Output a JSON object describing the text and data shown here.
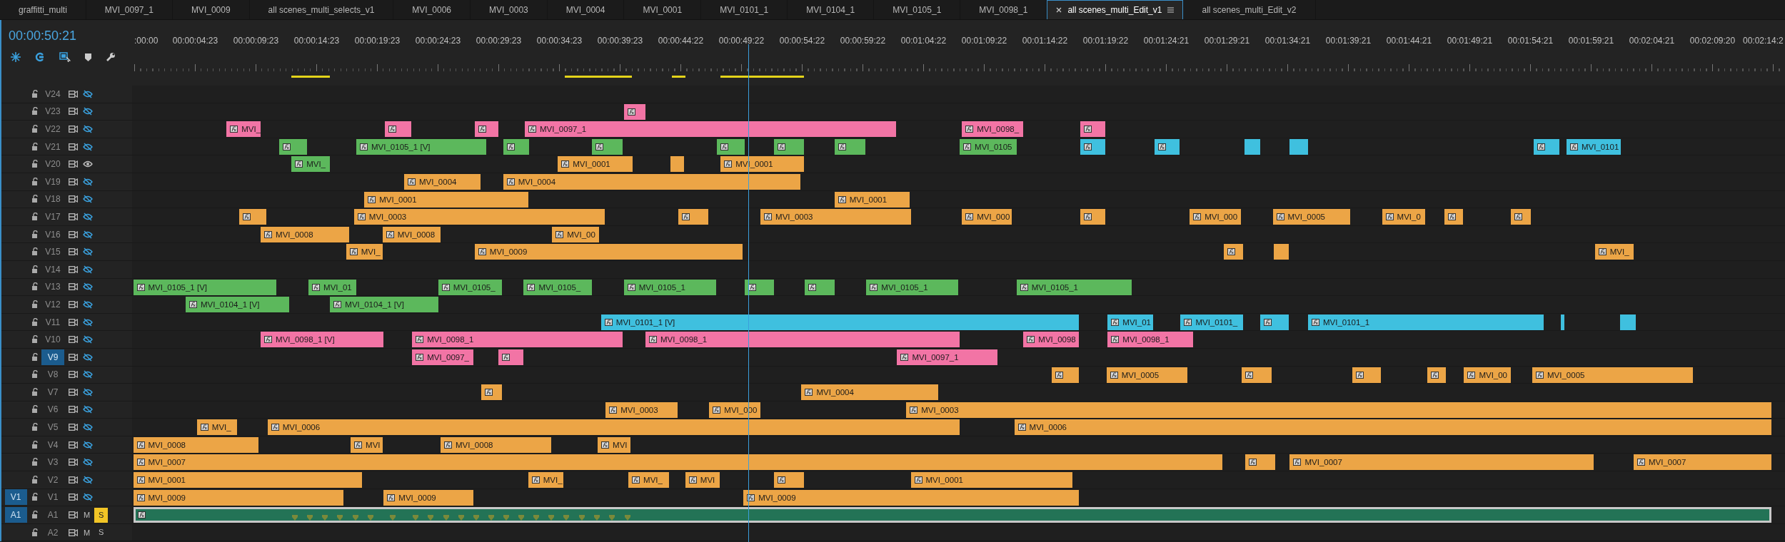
{
  "tabs": [
    {
      "label": "graffitti_multi",
      "selected": false
    },
    {
      "label": "MVI_0097_1",
      "selected": false
    },
    {
      "label": "MVI_0009",
      "selected": false
    },
    {
      "label": "all scenes_multi_selects_v1",
      "selected": false
    },
    {
      "label": "MVI_0006",
      "selected": false
    },
    {
      "label": "MVI_0003",
      "selected": false
    },
    {
      "label": "MVI_0004",
      "selected": false
    },
    {
      "label": "MVI_0001",
      "selected": false
    },
    {
      "label": "MVI_0101_1",
      "selected": false
    },
    {
      "label": "MVI_0104_1",
      "selected": false
    },
    {
      "label": "MVI_0105_1",
      "selected": false
    },
    {
      "label": "MVI_0098_1",
      "selected": false
    },
    {
      "label": "all scenes_multi_Edit_v1",
      "selected": true
    },
    {
      "label": "all scenes_multi_Edit_v2",
      "selected": false
    }
  ],
  "timecode": "00:00:50:21",
  "ruler": [
    ":00:00",
    "00:00:04:23",
    "00:00:09:23",
    "00:00:14:23",
    "00:00:19:23",
    "00:00:24:23",
    "00:00:29:23",
    "00:00:34:23",
    "00:00:39:23",
    "00:00:44:22",
    "00:00:49:22",
    "00:00:54:22",
    "00:00:59:22",
    "00:01:04:22",
    "00:01:09:22",
    "00:01:14:22",
    "00:01:19:22",
    "00:01:24:21",
    "00:01:29:21",
    "00:01:34:21",
    "00:01:39:21",
    "00:01:44:21",
    "00:01:49:21",
    "00:01:54:21",
    "00:01:59:21",
    "00:02:04:21",
    "00:02:09:20",
    "00:02:14:2"
  ],
  "tracks": [
    {
      "name": "V24",
      "kind": "video",
      "output": false,
      "targeted": false
    },
    {
      "name": "V23",
      "kind": "video",
      "output": false,
      "targeted": false,
      "clips": [
        {
          "color": "#f274a5",
          "fx": true
        }
      ]
    },
    {
      "name": "V22",
      "kind": "video",
      "output": false,
      "targeted": false,
      "clips": [
        {
          "label": "MVI_",
          "color": "#f274a5",
          "fx": true
        },
        {
          "color": "#f274a5",
          "fx": true
        },
        {
          "color": "#f274a5",
          "fx": true
        },
        {
          "label": "MVI_0097_1",
          "color": "#f274a5",
          "fx": true
        },
        {
          "label": "MVI_0098_",
          "color": "#f274a5",
          "fx": true
        },
        {
          "color": "#f274a5",
          "fx": true
        }
      ]
    },
    {
      "name": "V21",
      "kind": "video",
      "output": false,
      "targeted": false,
      "clips": [
        {
          "color": "#5cb85c",
          "fx": true
        },
        {
          "label": "MVI_0105_1 [V]",
          "color": "#5cb85c",
          "fx": true
        },
        {
          "color": "#5cb85c",
          "fx": true
        },
        {
          "color": "#5cb85c",
          "fx": true
        },
        {
          "color": "#5cb85c",
          "fx": true
        },
        {
          "color": "#5cb85c",
          "fx": true
        },
        {
          "color": "#5cb85c",
          "fx": true
        },
        {
          "label": "MVI_0105",
          "color": "#5cb85c",
          "fx": true
        },
        {
          "color": "#3fc0df",
          "fx": true
        },
        {
          "color": "#3fc0df",
          "fx": true
        },
        {
          "color": "#3fc0df",
          "fx": false
        },
        {
          "color": "#3fc0df",
          "fx": false
        },
        {
          "color": "#3fc0df",
          "fx": true
        },
        {
          "label": "MVI_0101",
          "color": "#3fc0df",
          "fx": true
        }
      ]
    },
    {
      "name": "V20",
      "kind": "video",
      "output": true,
      "targeted": false,
      "clips": [
        {
          "label": "MVI_",
          "color": "#5cb85c",
          "fx": true
        },
        {
          "label": "MVI_0001",
          "color": "#eca546",
          "fx": true
        },
        {
          "color": "#eca546",
          "fx": false
        },
        {
          "label": "MVI_0001",
          "color": "#eca546",
          "fx": true
        }
      ]
    },
    {
      "name": "V19",
      "kind": "video",
      "output": false,
      "targeted": false,
      "clips": [
        {
          "label": "MVI_0004",
          "color": "#eca546",
          "fx": true
        },
        {
          "label": "MVI_0004",
          "color": "#eca546",
          "fx": true
        }
      ]
    },
    {
      "name": "V18",
      "kind": "video",
      "output": false,
      "targeted": false,
      "clips": [
        {
          "label": "MVI_0001",
          "color": "#eca546",
          "fx": true
        },
        {
          "label": "MVI_0001",
          "color": "#eca546",
          "fx": true
        }
      ]
    },
    {
      "name": "V17",
      "kind": "video",
      "output": false,
      "targeted": false,
      "clips": [
        {
          "color": "#eca546",
          "fx": true
        },
        {
          "label": "MVI_0003",
          "color": "#eca546",
          "fx": true
        },
        {
          "color": "#eca546",
          "fx": true
        },
        {
          "label": "MVI_0003",
          "color": "#eca546",
          "fx": true
        },
        {
          "label": "MVI_000",
          "color": "#eca546",
          "fx": true
        },
        {
          "color": "#eca546",
          "fx": true
        },
        {
          "label": "MVI_000",
          "color": "#eca546",
          "fx": true
        },
        {
          "label": "MVI_0005",
          "color": "#eca546",
          "fx": true
        },
        {
          "label": "MVI_0",
          "color": "#eca546",
          "fx": true
        },
        {
          "color": "#eca546",
          "fx": true
        },
        {
          "color": "#eca546",
          "fx": true
        }
      ]
    },
    {
      "name": "V16",
      "kind": "video",
      "output": false,
      "targeted": false,
      "clips": [
        {
          "label": "MVI_0008",
          "color": "#eca546",
          "fx": true
        },
        {
          "label": "MVI_0008",
          "color": "#eca546",
          "fx": true
        },
        {
          "label": "MVI_00",
          "color": "#eca546",
          "fx": true
        }
      ]
    },
    {
      "name": "V15",
      "kind": "video",
      "output": false,
      "targeted": false,
      "clips": [
        {
          "label": "MVI_",
          "color": "#eca546",
          "fx": true
        },
        {
          "label": "MVI_0009",
          "color": "#eca546",
          "fx": true
        },
        {
          "color": "#eca546",
          "fx": true
        },
        {
          "color": "#eca546",
          "fx": false
        },
        {
          "label": "MVI_",
          "color": "#eca546",
          "fx": true
        }
      ]
    },
    {
      "name": "V14",
      "kind": "video",
      "output": false,
      "targeted": false
    },
    {
      "name": "V13",
      "kind": "video",
      "output": false,
      "targeted": false,
      "clips": [
        {
          "label": "MVI_0105_1 [V]",
          "color": "#5cb85c",
          "fx": true
        },
        {
          "label": "MVI_01",
          "color": "#5cb85c",
          "fx": true
        },
        {
          "label": "MVI_0105_",
          "color": "#5cb85c",
          "fx": true
        },
        {
          "label": "MVI_0105_",
          "color": "#5cb85c",
          "fx": true
        },
        {
          "label": "MVI_0105_1",
          "color": "#5cb85c",
          "fx": true
        },
        {
          "color": "#5cb85c",
          "fx": true
        },
        {
          "color": "#5cb85c",
          "fx": true
        },
        {
          "label": "MVI_0105_1",
          "color": "#5cb85c",
          "fx": true
        },
        {
          "label": "MVI_0105_1",
          "color": "#5cb85c",
          "fx": true
        }
      ]
    },
    {
      "name": "V12",
      "kind": "video",
      "output": false,
      "targeted": false,
      "clips": [
        {
          "label": "MVI_0104_1 [V]",
          "color": "#5cb85c",
          "fx": true
        },
        {
          "label": "MVI_0104_1 [V]",
          "color": "#5cb85c",
          "fx": true
        }
      ]
    },
    {
      "name": "V11",
      "kind": "video",
      "output": false,
      "targeted": false,
      "clips": [
        {
          "label": "MVI_0101_1 [V]",
          "color": "#3fc0df",
          "fx": true
        },
        {
          "label": "MVI_01",
          "color": "#3fc0df",
          "fx": true
        },
        {
          "label": "MVI_0101_",
          "color": "#3fc0df",
          "fx": true
        },
        {
          "color": "#3fc0df",
          "fx": true
        },
        {
          "label": "MVI_0101_1",
          "color": "#3fc0df",
          "fx": true
        },
        {
          "color": "#3fc0df",
          "fx": false
        },
        {
          "color": "#3fc0df",
          "fx": false
        }
      ]
    },
    {
      "name": "V10",
      "kind": "video",
      "output": false,
      "targeted": false,
      "clips": [
        {
          "label": "MVI_0098_1 [V]",
          "color": "#f274a5",
          "fx": true
        },
        {
          "label": "MVI_0098_1",
          "color": "#f274a5",
          "fx": true
        },
        {
          "label": "MVI_0098_1",
          "color": "#f274a5",
          "fx": true
        },
        {
          "label": "MVI_0098",
          "color": "#f274a5",
          "fx": true
        },
        {
          "label": "MVI_0098_1",
          "color": "#f274a5",
          "fx": true
        }
      ]
    },
    {
      "name": "V9",
      "kind": "video",
      "output": false,
      "targeted": true,
      "clips": [
        {
          "label": "MVI_0097_",
          "color": "#f274a5",
          "fx": true
        },
        {
          "color": "#f274a5",
          "fx": true
        },
        {
          "label": "MVI_0097_1",
          "color": "#f274a5",
          "fx": true
        }
      ]
    },
    {
      "name": "V8",
      "kind": "video",
      "output": false,
      "targeted": false,
      "clips": [
        {
          "color": "#eca546",
          "fx": true
        },
        {
          "label": "MVI_0005",
          "color": "#eca546",
          "fx": true
        },
        {
          "color": "#eca546",
          "fx": true
        },
        {
          "color": "#eca546",
          "fx": true
        },
        {
          "color": "#eca546",
          "fx": true
        },
        {
          "label": "MVI_00",
          "color": "#eca546",
          "fx": true
        },
        {
          "label": "MVI_0005",
          "color": "#eca546",
          "fx": true
        }
      ]
    },
    {
      "name": "V7",
      "kind": "video",
      "output": false,
      "targeted": false,
      "clips": [
        {
          "color": "#eca546",
          "fx": true
        },
        {
          "label": "MVI_0004",
          "color": "#eca546",
          "fx": true
        }
      ]
    },
    {
      "name": "V6",
      "kind": "video",
      "output": false,
      "targeted": false,
      "clips": [
        {
          "label": "MVI_0003",
          "color": "#eca546",
          "fx": true
        },
        {
          "label": "MVI_000",
          "color": "#eca546",
          "fx": true
        },
        {
          "label": "MVI_0003",
          "color": "#eca546",
          "fx": true
        }
      ]
    },
    {
      "name": "V5",
      "kind": "video",
      "output": false,
      "targeted": false,
      "clips": [
        {
          "label": "MVI_",
          "color": "#eca546",
          "fx": true
        },
        {
          "label": "MVI_0006",
          "color": "#eca546",
          "fx": true
        },
        {
          "label": "MVI_0006",
          "color": "#eca546",
          "fx": true
        }
      ]
    },
    {
      "name": "V4",
      "kind": "video",
      "output": false,
      "targeted": false,
      "clips": [
        {
          "label": "MVI_0008",
          "color": "#eca546",
          "fx": true
        },
        {
          "label": "MVI",
          "color": "#eca546",
          "fx": true
        },
        {
          "label": "MVI_0008",
          "color": "#eca546",
          "fx": true
        },
        {
          "label": "MVI",
          "color": "#eca546",
          "fx": true
        }
      ]
    },
    {
      "name": "V3",
      "kind": "video",
      "output": false,
      "targeted": false,
      "clips": [
        {
          "label": "MVI_0007",
          "color": "#eca546",
          "fx": true
        },
        {
          "color": "#eca546",
          "fx": true
        },
        {
          "label": "MVI_0007",
          "color": "#eca546",
          "fx": true
        },
        {
          "label": "MVI_0007",
          "color": "#eca546",
          "fx": true
        }
      ]
    },
    {
      "name": "V2",
      "kind": "video",
      "output": false,
      "targeted": false,
      "clips": [
        {
          "label": "MVI_0001",
          "color": "#eca546",
          "fx": true
        },
        {
          "label": "MVI_",
          "color": "#eca546",
          "fx": true
        },
        {
          "label": "MVI_",
          "color": "#eca546",
          "fx": true
        },
        {
          "label": "MVI",
          "color": "#eca546",
          "fx": true
        },
        {
          "color": "#eca546",
          "fx": true
        },
        {
          "label": "MVI_0001",
          "color": "#eca546",
          "fx": true
        }
      ]
    },
    {
      "name": "V1",
      "kind": "video",
      "output": false,
      "targeted": false,
      "source_patch": "V1",
      "clips": [
        {
          "label": "MVI_0009",
          "color": "#eca546",
          "fx": true
        },
        {
          "label": "MVI_0009",
          "color": "#eca546",
          "fx": true
        },
        {
          "label": "MVI_0009",
          "color": "#eca546",
          "fx": true
        }
      ]
    },
    {
      "name": "A1",
      "kind": "audio",
      "targeted": false,
      "source_patch": "A1",
      "mute": "M",
      "solo": "S",
      "solo_on": true,
      "clips": [
        {
          "color": "#237356",
          "fx": true,
          "selected": true
        }
      ]
    },
    {
      "name": "A2",
      "kind": "audio",
      "targeted": false,
      "mute": "M",
      "solo": "S",
      "solo_on": false
    }
  ]
}
